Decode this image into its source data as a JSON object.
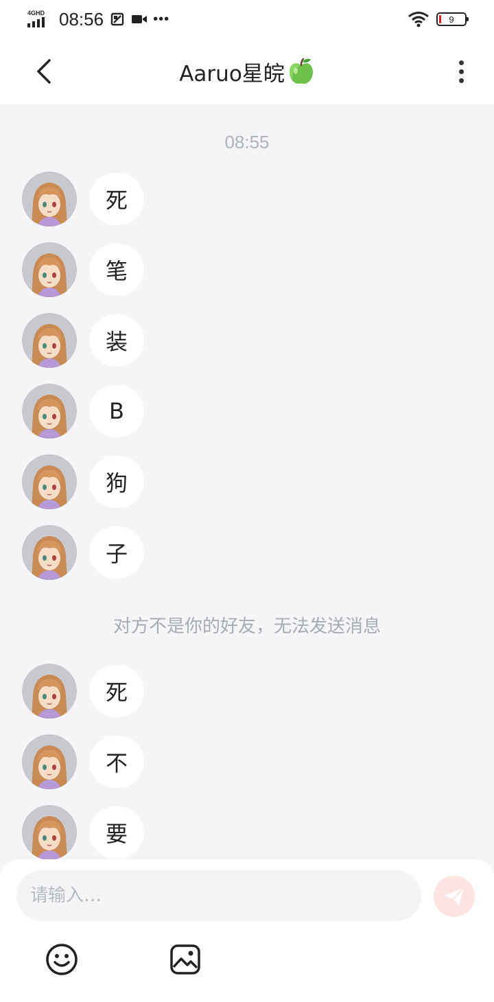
{
  "status_bar": {
    "network": "4GHD",
    "time": "08:56",
    "battery": "9"
  },
  "header": {
    "title": "Aaruo星皖"
  },
  "chat": {
    "timestamp": "08:55",
    "messages_before": [
      "死",
      "笔",
      "装",
      "B",
      "狗",
      "子"
    ],
    "notice": "对方不是你的好友，无法发送消息",
    "messages_after": [
      "死",
      "不",
      "要"
    ]
  },
  "input": {
    "placeholder": "请输入…"
  },
  "colors": {
    "background": "#f4f5f7",
    "bubble": "#ffffff",
    "send_button": "#fde4e2",
    "muted_text": "#b0b3b8"
  },
  "icons": [
    "back-arrow-icon",
    "more-vertical-icon",
    "green-apple-icon",
    "paper-plane-icon",
    "emoji-icon",
    "image-icon"
  ]
}
